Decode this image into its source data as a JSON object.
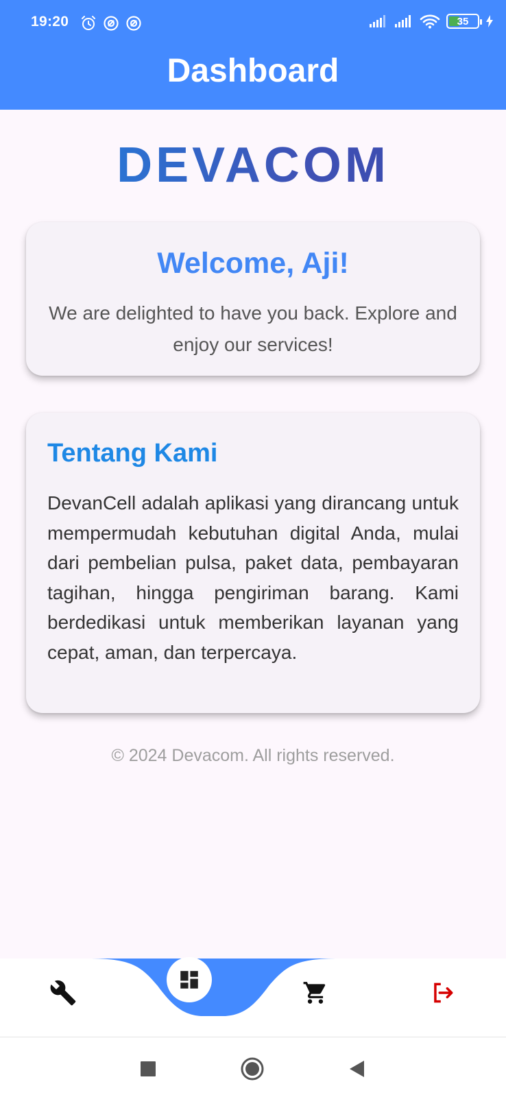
{
  "status_bar": {
    "time": "19:20",
    "battery_level": "35",
    "left_icons": [
      "alarm-icon",
      "sync-icon",
      "sync-icon"
    ],
    "right_icons": [
      "signal-icon",
      "signal-icon",
      "wifi-icon",
      "battery-icon",
      "charging-icon"
    ]
  },
  "header": {
    "title": "Dashboard",
    "background_color": "#448aff"
  },
  "brand": {
    "name": "DEVACOM",
    "gradient": [
      "#1e88e5",
      "#3949ab"
    ]
  },
  "welcome_card": {
    "title": "Welcome, Aji!",
    "message": "We are delighted to have you back. Explore and enjoy our services!"
  },
  "about_card": {
    "title": "Tentang Kami",
    "body": "DevanCell adalah aplikasi yang dirancang untuk mempermudah kebutuhan digital Anda, mulai dari pembelian pulsa, paket data, pembayaran tagihan, hingga pengiriman barang. Kami berdedikasi untuk memberikan layanan yang cepat, aman, dan terpercaya."
  },
  "footer": {
    "copyright": "© 2024 Devacom. All rights reserved."
  },
  "bottom_nav": {
    "items": [
      {
        "icon": "wrench-icon",
        "active": false
      },
      {
        "icon": "dashboard-icon",
        "active": true
      },
      {
        "icon": "cart-icon",
        "active": false
      },
      {
        "icon": "logout-icon",
        "active": false,
        "color": "#d50000"
      }
    ],
    "accent_color": "#448aff"
  },
  "system_nav": {
    "buttons": [
      "recent-apps-icon",
      "home-icon",
      "back-icon"
    ]
  }
}
